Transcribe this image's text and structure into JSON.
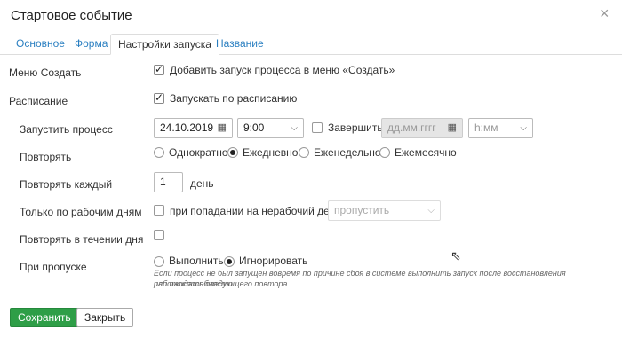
{
  "dialog": {
    "title": "Стартовое событие",
    "close_label": "×"
  },
  "tabs": [
    {
      "label": "Основное"
    },
    {
      "label": "Форма"
    },
    {
      "label": "Настройки запуска"
    },
    {
      "label": "Название"
    }
  ],
  "rows": {
    "create_menu": {
      "label": "Меню Создать",
      "checkbox_label": "Добавить запуск процесса в меню «Создать»",
      "checked": true
    },
    "schedule": {
      "label": "Расписание",
      "checkbox_label": "Запускать по расписанию",
      "checked": true
    },
    "start": {
      "label": "Запустить процесс",
      "date_value": "24.10.2019",
      "time_value": "9:00",
      "finish_label": "Завершить",
      "end_date_placeholder": "дд.мм.гггг",
      "end_time_placeholder": "h:мм"
    },
    "repeat": {
      "label": "Повторять",
      "options": [
        "Однократно",
        "Ежедневно",
        "Еженедельно",
        "Ежемесячно"
      ],
      "selected": "Ежедневно"
    },
    "repeat_every": {
      "label": "Повторять каждый",
      "value": "1",
      "unit": "день"
    },
    "workdays": {
      "label": "Только по рабочим дням",
      "checkbox_label": "при попадании на нерабочий день",
      "select_value": "пропустить"
    },
    "repeat_during_day": {
      "label": "Повторять в течении дня"
    },
    "on_skip": {
      "label": "При пропуске",
      "options": [
        "Выполнить",
        "Игнорировать"
      ],
      "selected": "Игнорировать",
      "help_line1": "Если процесс не был запущен вовремя по причине сбоя в системе выполнить запуск после восстановления работоспособности",
      "help_line2": "или ожидать следующего повтора"
    }
  },
  "footer": {
    "save_label": "Сохранить",
    "close_label": "Закрыть"
  },
  "icons": {
    "calendar": "calendar-icon",
    "chevron": "chevron-down-icon"
  },
  "colors": {
    "accent": "#2a7fc1",
    "save": "#2e9e47"
  }
}
